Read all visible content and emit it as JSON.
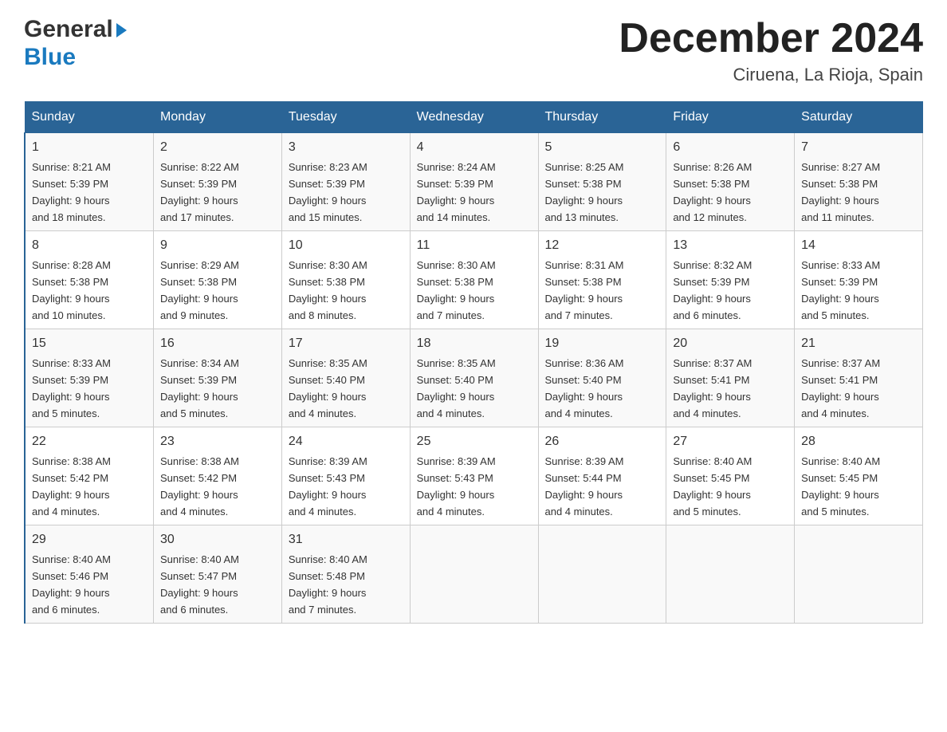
{
  "header": {
    "logo_general": "General",
    "logo_blue": "Blue",
    "month_year": "December 2024",
    "location": "Ciruena, La Rioja, Spain"
  },
  "calendar": {
    "weekdays": [
      "Sunday",
      "Monday",
      "Tuesday",
      "Wednesday",
      "Thursday",
      "Friday",
      "Saturday"
    ],
    "weeks": [
      [
        {
          "day": "1",
          "sunrise": "8:21 AM",
          "sunset": "5:39 PM",
          "daylight": "9 hours and 18 minutes."
        },
        {
          "day": "2",
          "sunrise": "8:22 AM",
          "sunset": "5:39 PM",
          "daylight": "9 hours and 17 minutes."
        },
        {
          "day": "3",
          "sunrise": "8:23 AM",
          "sunset": "5:39 PM",
          "daylight": "9 hours and 15 minutes."
        },
        {
          "day": "4",
          "sunrise": "8:24 AM",
          "sunset": "5:39 PM",
          "daylight": "9 hours and 14 minutes."
        },
        {
          "day": "5",
          "sunrise": "8:25 AM",
          "sunset": "5:38 PM",
          "daylight": "9 hours and 13 minutes."
        },
        {
          "day": "6",
          "sunrise": "8:26 AM",
          "sunset": "5:38 PM",
          "daylight": "9 hours and 12 minutes."
        },
        {
          "day": "7",
          "sunrise": "8:27 AM",
          "sunset": "5:38 PM",
          "daylight": "9 hours and 11 minutes."
        }
      ],
      [
        {
          "day": "8",
          "sunrise": "8:28 AM",
          "sunset": "5:38 PM",
          "daylight": "9 hours and 10 minutes."
        },
        {
          "day": "9",
          "sunrise": "8:29 AM",
          "sunset": "5:38 PM",
          "daylight": "9 hours and 9 minutes."
        },
        {
          "day": "10",
          "sunrise": "8:30 AM",
          "sunset": "5:38 PM",
          "daylight": "9 hours and 8 minutes."
        },
        {
          "day": "11",
          "sunrise": "8:30 AM",
          "sunset": "5:38 PM",
          "daylight": "9 hours and 7 minutes."
        },
        {
          "day": "12",
          "sunrise": "8:31 AM",
          "sunset": "5:38 PM",
          "daylight": "9 hours and 7 minutes."
        },
        {
          "day": "13",
          "sunrise": "8:32 AM",
          "sunset": "5:39 PM",
          "daylight": "9 hours and 6 minutes."
        },
        {
          "day": "14",
          "sunrise": "8:33 AM",
          "sunset": "5:39 PM",
          "daylight": "9 hours and 5 minutes."
        }
      ],
      [
        {
          "day": "15",
          "sunrise": "8:33 AM",
          "sunset": "5:39 PM",
          "daylight": "9 hours and 5 minutes."
        },
        {
          "day": "16",
          "sunrise": "8:34 AM",
          "sunset": "5:39 PM",
          "daylight": "9 hours and 5 minutes."
        },
        {
          "day": "17",
          "sunrise": "8:35 AM",
          "sunset": "5:40 PM",
          "daylight": "9 hours and 4 minutes."
        },
        {
          "day": "18",
          "sunrise": "8:35 AM",
          "sunset": "5:40 PM",
          "daylight": "9 hours and 4 minutes."
        },
        {
          "day": "19",
          "sunrise": "8:36 AM",
          "sunset": "5:40 PM",
          "daylight": "9 hours and 4 minutes."
        },
        {
          "day": "20",
          "sunrise": "8:37 AM",
          "sunset": "5:41 PM",
          "daylight": "9 hours and 4 minutes."
        },
        {
          "day": "21",
          "sunrise": "8:37 AM",
          "sunset": "5:41 PM",
          "daylight": "9 hours and 4 minutes."
        }
      ],
      [
        {
          "day": "22",
          "sunrise": "8:38 AM",
          "sunset": "5:42 PM",
          "daylight": "9 hours and 4 minutes."
        },
        {
          "day": "23",
          "sunrise": "8:38 AM",
          "sunset": "5:42 PM",
          "daylight": "9 hours and 4 minutes."
        },
        {
          "day": "24",
          "sunrise": "8:39 AM",
          "sunset": "5:43 PM",
          "daylight": "9 hours and 4 minutes."
        },
        {
          "day": "25",
          "sunrise": "8:39 AM",
          "sunset": "5:43 PM",
          "daylight": "9 hours and 4 minutes."
        },
        {
          "day": "26",
          "sunrise": "8:39 AM",
          "sunset": "5:44 PM",
          "daylight": "9 hours and 4 minutes."
        },
        {
          "day": "27",
          "sunrise": "8:40 AM",
          "sunset": "5:45 PM",
          "daylight": "9 hours and 5 minutes."
        },
        {
          "day": "28",
          "sunrise": "8:40 AM",
          "sunset": "5:45 PM",
          "daylight": "9 hours and 5 minutes."
        }
      ],
      [
        {
          "day": "29",
          "sunrise": "8:40 AM",
          "sunset": "5:46 PM",
          "daylight": "9 hours and 6 minutes."
        },
        {
          "day": "30",
          "sunrise": "8:40 AM",
          "sunset": "5:47 PM",
          "daylight": "9 hours and 6 minutes."
        },
        {
          "day": "31",
          "sunrise": "8:40 AM",
          "sunset": "5:48 PM",
          "daylight": "9 hours and 7 minutes."
        },
        null,
        null,
        null,
        null
      ]
    ]
  },
  "labels": {
    "sunrise": "Sunrise:",
    "sunset": "Sunset:",
    "daylight": "Daylight:"
  }
}
